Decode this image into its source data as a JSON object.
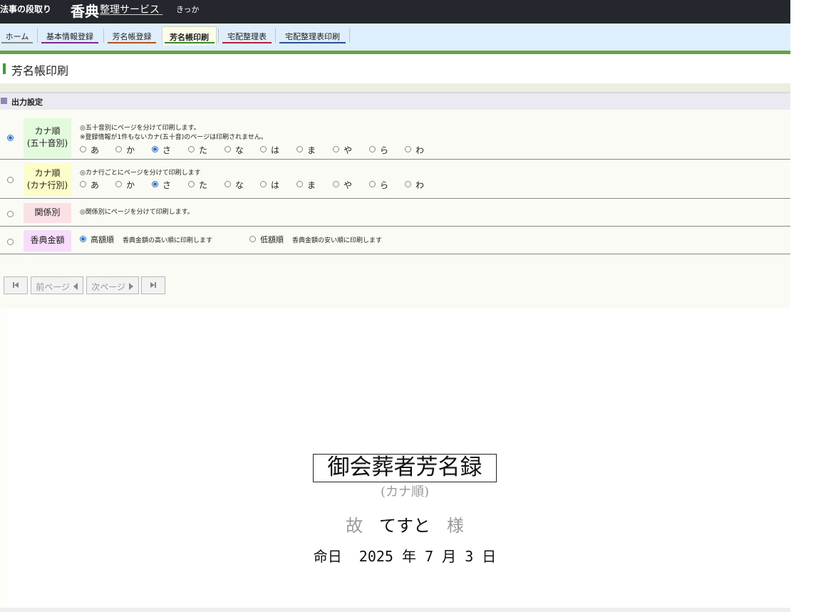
{
  "header": {
    "site_prefix": "法事の段取り",
    "logo_bold": "香典",
    "logo_rest": "整理サービス",
    "user": "きっか"
  },
  "nav": {
    "tabs": [
      {
        "label": "ホーム",
        "color": "#888888",
        "active": false
      },
      {
        "label": "基本情報登録",
        "color": "#7a2a8e",
        "active": false
      },
      {
        "label": "芳名帳登録",
        "color": "#b8501e",
        "active": false
      },
      {
        "label": "芳名帳印刷",
        "color": "#3b8a2c",
        "active": true
      },
      {
        "label": "宅配整理表",
        "color": "#b0213f",
        "active": false
      },
      {
        "label": "宅配整理表印刷",
        "color": "#2a4f9a",
        "active": false
      }
    ]
  },
  "page": {
    "title": "芳名帳印刷"
  },
  "section": {
    "title": "出力設定"
  },
  "options": {
    "kana50": {
      "label_line1": "カナ順",
      "label_line2": "(五十音別)",
      "note1": "◎五十音別にページを分けて印刷します。",
      "note2": "※登録情報が1件もないカナ(五十音)のページは印刷されません。",
      "selected": true,
      "label_bg": "#e2fbdc"
    },
    "kanaRow": {
      "label_line1": "カナ順",
      "label_line2": "(カナ行別)",
      "note1": "◎カナ行ごとにページを分けて印刷します",
      "selected": false,
      "label_bg": "#fdfdc8"
    },
    "relation": {
      "label": "関係別",
      "note1": "◎関係別にページを分けて印刷します。",
      "selected": false,
      "label_bg": "#fbe0e5"
    },
    "amount": {
      "label": "香典金額",
      "selected": false,
      "label_bg": "#f8dcfb",
      "high_label": "高額順",
      "high_note": "香典金額の高い順に印刷します",
      "high_selected": true,
      "low_label": "低額順",
      "low_note": "香典金額の安い順に印刷します",
      "low_selected": false
    },
    "kana_chars": [
      "あ",
      "か",
      "さ",
      "た",
      "な",
      "は",
      "ま",
      "や",
      "ら",
      "わ"
    ],
    "kana_selected_index": 2
  },
  "pager": {
    "first_icon": "first-page-icon",
    "prev_label": "前ページ",
    "next_label": "次ページ",
    "last_icon": "last-page-icon"
  },
  "preview": {
    "title": "御会葬者芳名録",
    "subtitle": "(カナ順)",
    "prefix": "故",
    "name": "てすと",
    "suffix": "様",
    "date_label": "命日",
    "year": "2025",
    "year_unit": "年",
    "month": "7",
    "month_unit": "月",
    "day": "3",
    "day_unit": "日"
  }
}
